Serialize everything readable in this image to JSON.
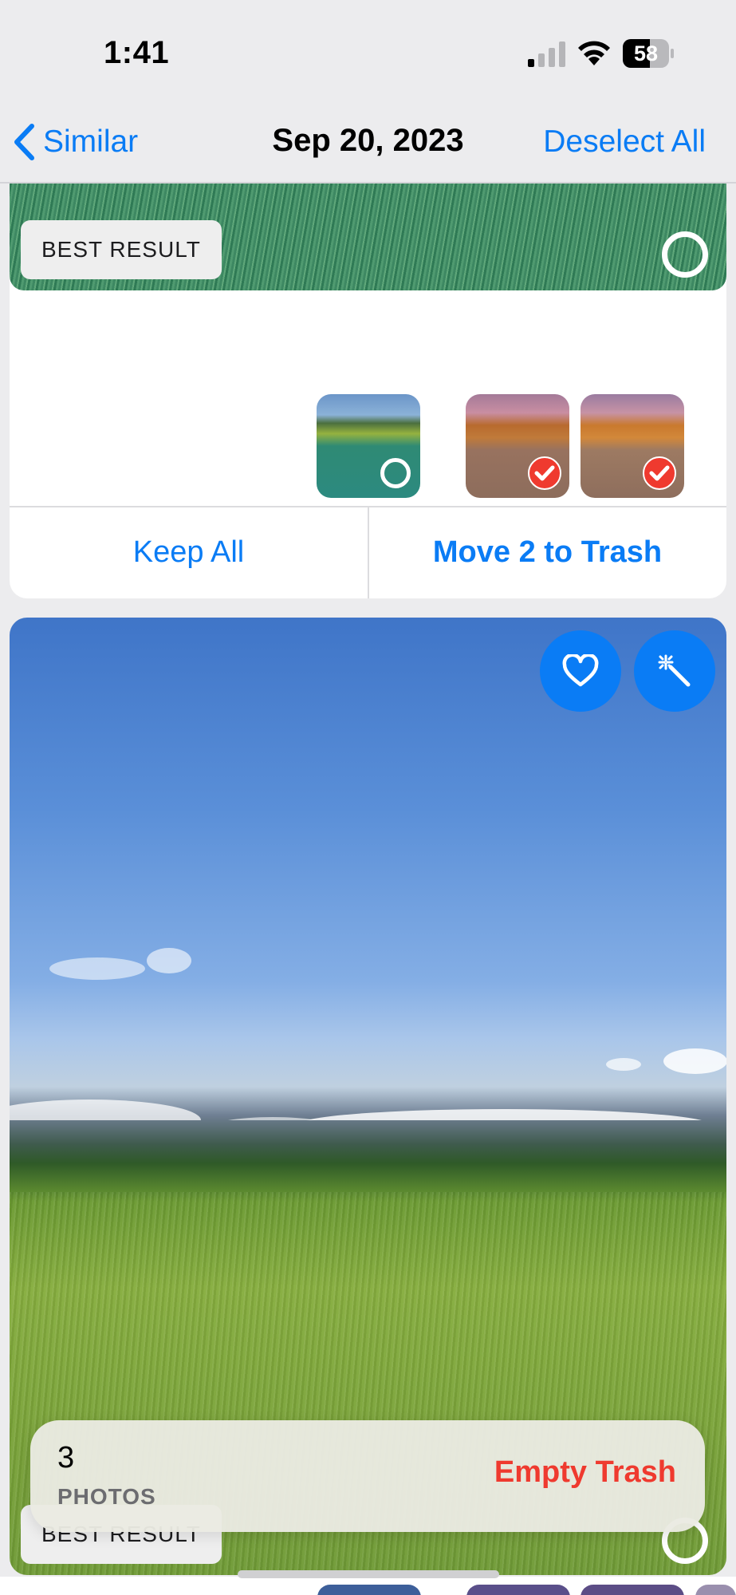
{
  "status_bar": {
    "time": "1:41",
    "battery": "58"
  },
  "nav": {
    "back_label": "Similar",
    "title": "Sep 20, 2023",
    "deselect_label": "Deselect All"
  },
  "top_card": {
    "badge": "BEST RESULT",
    "actions": {
      "keep_all": "Keep All",
      "move_to_trash": "Move 2 to Trash"
    },
    "thumbnails": [
      {
        "state": "unselected"
      },
      {
        "state": "selected"
      },
      {
        "state": "selected"
      }
    ]
  },
  "main_photo": {
    "badge": "BEST RESULT"
  },
  "trash_bar": {
    "count": "3",
    "unit": "PHOTOS",
    "action": "Empty Trash"
  },
  "colors": {
    "accent": "#0a7cf5",
    "destructive": "#ef3a2f"
  },
  "icons": [
    "chevron-left-icon",
    "cellular-signal-icon",
    "wifi-icon",
    "battery-icon",
    "heart-icon",
    "magic-wand-icon",
    "checkmark-icon",
    "selection-ring-icon"
  ]
}
